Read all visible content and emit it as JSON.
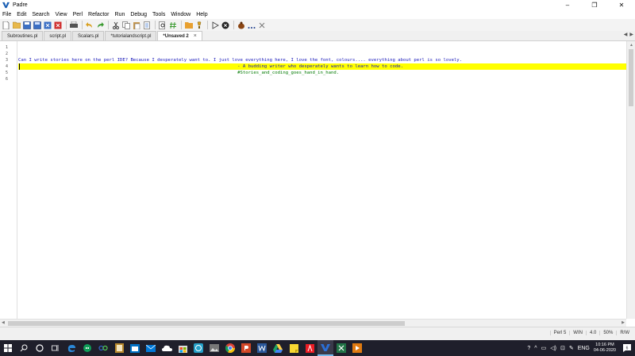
{
  "window": {
    "title": "Padre",
    "controls": [
      "–",
      "❐",
      "✕"
    ]
  },
  "menu": [
    "File",
    "Edit",
    "Search",
    "View",
    "Perl",
    "Refactor",
    "Run",
    "Debug",
    "Tools",
    "Window",
    "Help"
  ],
  "toolbar_icons": [
    "new-file-icon",
    "open-file-icon",
    "save-icon",
    "save-all-icon",
    "close-file-icon",
    "close-all-icon",
    "print-icon",
    "undo-icon",
    "redo-icon",
    "cut-icon",
    "copy-icon",
    "paste-icon",
    "select-all-icon",
    "find-icon",
    "comment-icon",
    "open-folder-icon",
    "debug-icon",
    "run-icon",
    "stop-icon",
    "bug-icon",
    "more-icon",
    "clear-icon"
  ],
  "tabs": [
    {
      "label": "Subroutines.pl",
      "active": false
    },
    {
      "label": "script.pl",
      "active": false
    },
    {
      "label": "Scalars.pl",
      "active": false
    },
    {
      "label": "*tutorialandscript.pl",
      "active": false
    },
    {
      "label": "*Unsaved 2",
      "active": true
    }
  ],
  "tab_close": "×",
  "editor": {
    "line_numbers": [
      "1",
      "2",
      "3",
      "4",
      "5",
      "6"
    ],
    "lines": [
      "",
      "",
      "Can I write stories here on the perl IDE? Because I desperately want to. I just love everything here, I love the font, colours.... everything about perl is so lovely.",
      "                                                                                  - A budding writer who desperately wants to learn how to code.",
      "                                                                                  #Stories_and_coding_goes_hand_in_hand.",
      ""
    ],
    "current_line_index": 3,
    "colors": {
      "text_blue": "#1414b8",
      "text_green": "#007a00",
      "current_line": "#ffff00"
    }
  },
  "status": {
    "language": "Perl 5",
    "mode": "WIN",
    "version": "4.0",
    "zoom": "50%",
    "access": "R/W"
  },
  "taskbar": {
    "icons": [
      "windows-start-icon",
      "search-icon",
      "cortana-icon",
      "task-view-icon",
      "edge-icon",
      "hangouts-icon",
      "link-icon",
      "word-doc-icon",
      "outlook-calendar-icon",
      "mail-icon",
      "onedrive-icon",
      "store-icon",
      "whatsapp-icon",
      "photos-icon",
      "chrome-icon",
      "powerpoint-icon",
      "word-icon",
      "drive-icon",
      "sticky-notes-icon",
      "acrobat-icon",
      "padre-icon",
      "excel-icon",
      "media-player-icon"
    ],
    "active_icon": "padre-icon",
    "tray_language": "ENG",
    "time": "10:16 PM",
    "date": "04-06-2020",
    "notifications": "6"
  }
}
